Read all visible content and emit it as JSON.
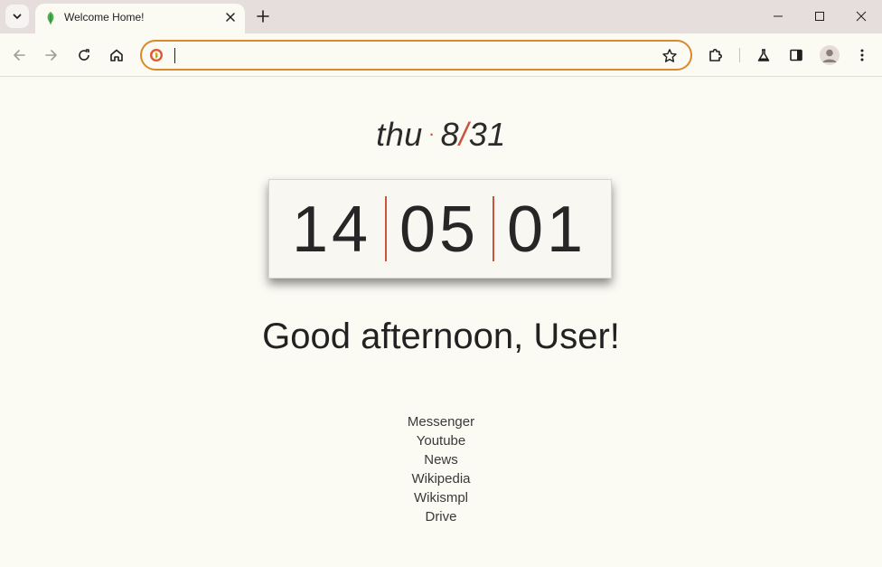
{
  "browser": {
    "tab": {
      "title": "Welcome Home!"
    },
    "omnibox": {
      "value": "",
      "placeholder": ""
    }
  },
  "page": {
    "date": {
      "weekday": "thu",
      "month": "8",
      "day": "31"
    },
    "clock": {
      "hours": "14",
      "minutes": "05",
      "seconds": "01"
    },
    "greeting": "Good afternoon, User!",
    "links": [
      {
        "label": "Messenger"
      },
      {
        "label": "Youtube"
      },
      {
        "label": "News"
      },
      {
        "label": "Wikipedia"
      },
      {
        "label": "Wikismpl"
      },
      {
        "label": "Drive"
      }
    ]
  },
  "colors": {
    "accent": "#c8553d",
    "omnibox_focus": "#d98a2b",
    "page_bg": "#fbfaf3",
    "favicon": "#4caf50"
  }
}
